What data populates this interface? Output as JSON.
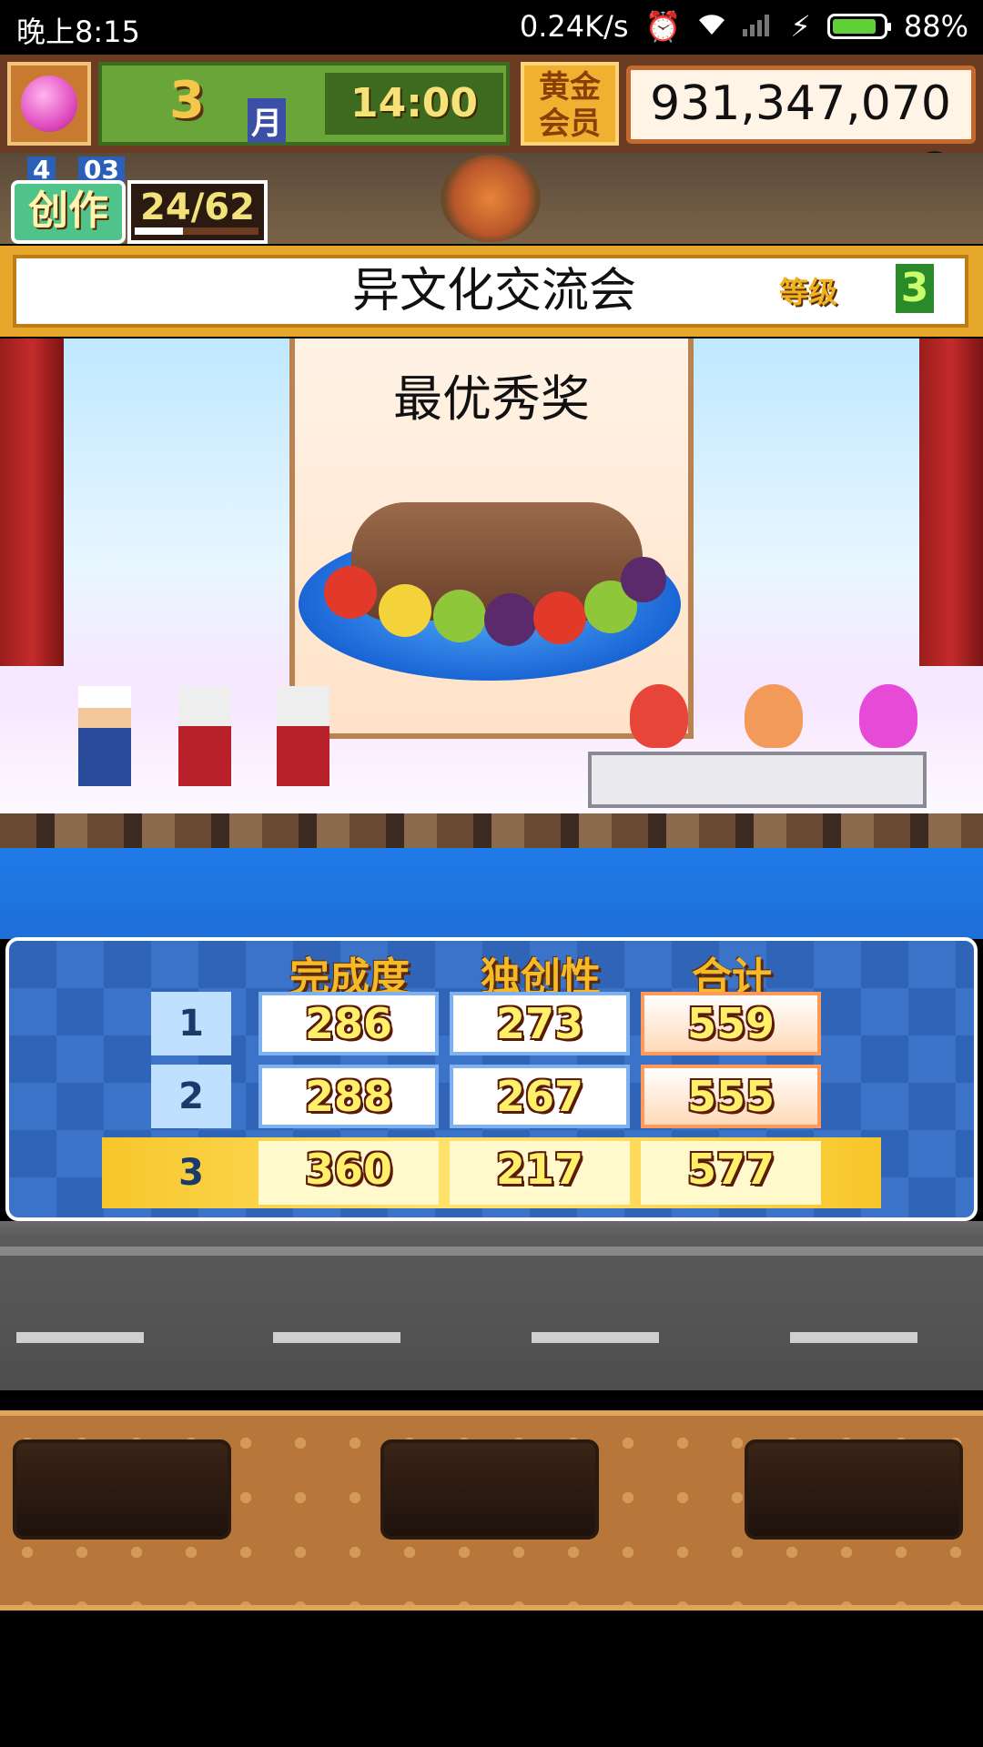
{
  "status_bar": {
    "time": "晚上8:15",
    "net_speed": "0.24K/s",
    "battery": "88%",
    "battery_level": 0.88
  },
  "hud": {
    "month": "3",
    "month_label": "月",
    "clock": "14:00",
    "membership_label": "黄金会员",
    "gold": "931,347,070 G"
  },
  "creation": {
    "level_a": "4",
    "level_b": "03",
    "label": "创作",
    "count": "24/62",
    "progress": 0.39
  },
  "contest": {
    "title": "异文化交流会",
    "grade_label": "等级",
    "grade_value": "3",
    "award": "最优秀奖"
  },
  "scoreboard": {
    "headers": [
      "完成度",
      "独创性",
      "合计"
    ],
    "rows": [
      {
        "rank": "1",
        "completion": "286",
        "originality": "273",
        "total": "559"
      },
      {
        "rank": "2",
        "completion": "288",
        "originality": "267",
        "total": "555"
      },
      {
        "rank": "3",
        "completion": "360",
        "originality": "217",
        "total": "577"
      }
    ],
    "winner_rank": "3"
  },
  "colors": {
    "accent_gold": "#f6b927",
    "board_blue": "#3b73c8",
    "highlight_yellow": "#ffe068"
  },
  "icons": [
    "alarm-icon",
    "wifi-icon",
    "signal-icon",
    "charging-icon",
    "battery-icon",
    "blossom-tree-icon"
  ]
}
